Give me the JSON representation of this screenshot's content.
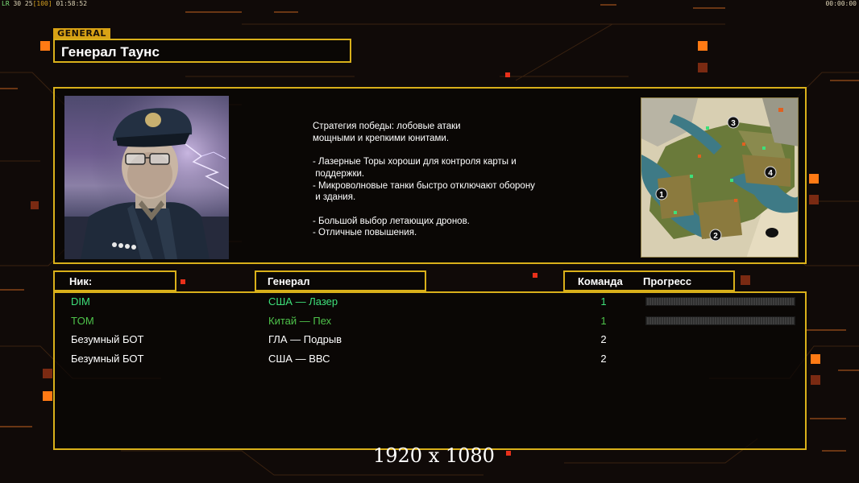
{
  "hud": {
    "lr": "LR",
    "stats": "30 25",
    "stat_bracket": "[100]",
    "game_clock": "01:58:52",
    "right_clock": "00:00:00"
  },
  "general": {
    "tag": "GENERAL",
    "name": "Генерал Таунс",
    "description": "Стратегия победы: лобовые атаки\nмощными и крепкими юнитами.\n\n- Лазерные Торы хороши для контроля карты и\n поддержки.\n- Микроволновые танки быстро отключают оборону\n и здания.\n\n- Большой выбор летающих дронов.\n- Отличные повышения."
  },
  "minimap": {
    "labels": [
      "1",
      "2",
      "3",
      "4"
    ]
  },
  "table": {
    "headers": {
      "nick": "Ник:",
      "general": "Генерал",
      "team": "Команда",
      "progress": "Прогресс"
    },
    "rows": [
      {
        "nick": "DIM",
        "general": "США — Лазер",
        "team": "1",
        "color": "#3ee07a",
        "progress": 0
      },
      {
        "nick": "TOM",
        "general": "Китай — Пех",
        "team": "1",
        "color": "#4ec24a",
        "progress": 0
      },
      {
        "nick": "Безумный БОТ",
        "general": "ГЛА — Подрыв",
        "team": "2",
        "color": "#ffffff"
      },
      {
        "nick": "Безумный БОТ",
        "general": "США — ВВС",
        "team": "2",
        "color": "#ffffff"
      }
    ]
  },
  "resolution": "1920 x 1080",
  "colors": {
    "accent": "#d9b01a",
    "background": "#100a08",
    "orange_marker": "#ff7a14"
  }
}
